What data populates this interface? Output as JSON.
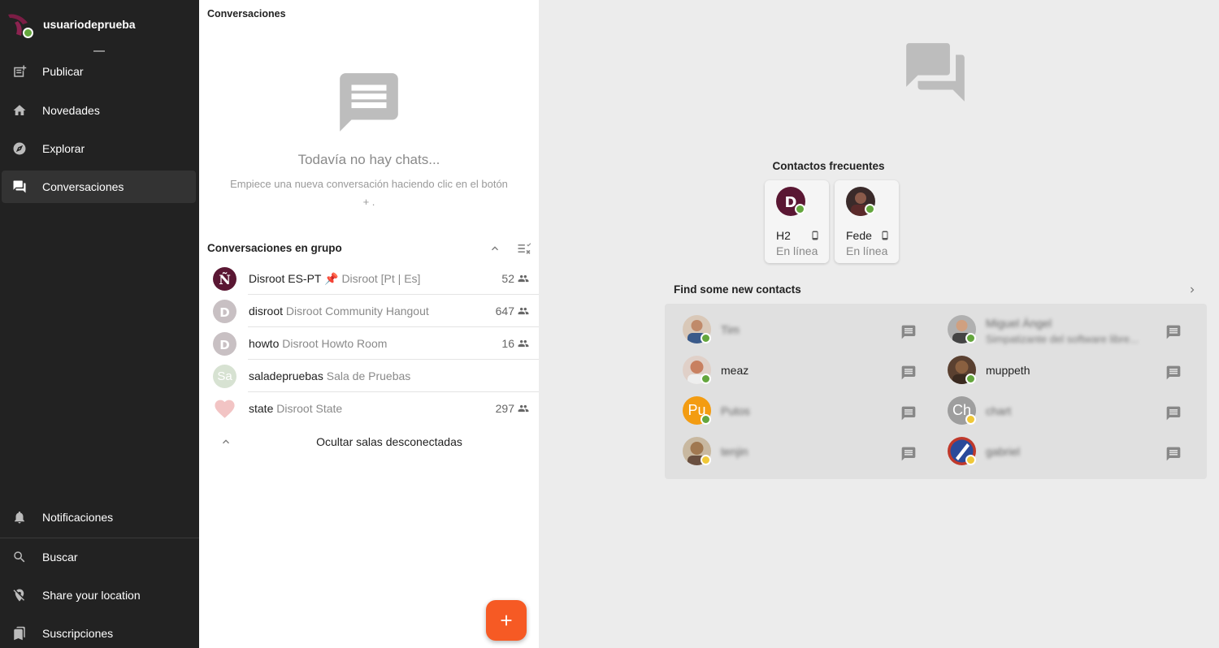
{
  "sidebar": {
    "username": "usuariodeprueba",
    "items": [
      {
        "label": "Publicar",
        "icon": "compose-icon"
      },
      {
        "label": "Novedades",
        "icon": "home-icon"
      },
      {
        "label": "Explorar",
        "icon": "compass-icon"
      },
      {
        "label": "Conversaciones",
        "icon": "chat-icon",
        "active": true
      }
    ],
    "bottom_items": [
      {
        "label": "Notificaciones",
        "icon": "bell-icon"
      },
      {
        "label": "Buscar",
        "icon": "search-icon"
      },
      {
        "label": "Share your location",
        "icon": "location-off-icon"
      },
      {
        "label": "Suscripciones",
        "icon": "bookmarks-icon"
      }
    ]
  },
  "conversations": {
    "title": "Conversaciones",
    "empty_title": "Todavía no hay chats...",
    "empty_subtitle": "Empiece una nueva conversación haciendo clic en el botón + .",
    "group_header": "Conversaciones en grupo",
    "rooms": [
      {
        "name": "Disroot ES-PT",
        "desc": "Disroot [Pt | Es]",
        "pinned": true,
        "count": "52"
      },
      {
        "name": "disroot",
        "desc": "Disroot Community Hangout",
        "count": "647"
      },
      {
        "name": "howto",
        "desc": "Disroot Howto Room",
        "count": "16"
      },
      {
        "name": "saladepruebas",
        "desc": "Sala de Pruebas",
        "initials": "Sa",
        "count": ""
      },
      {
        "name": "state",
        "desc": "Disroot State",
        "count": "297"
      }
    ],
    "hide_offline": "Ocultar salas desconectadas",
    "fab_label": "+"
  },
  "main": {
    "frequent_title": "Contactos frecuentes",
    "frequent": [
      {
        "name": "H2",
        "status": "En línea"
      },
      {
        "name": "Fede",
        "status": "En línea"
      }
    ],
    "find_title": "Find some new contacts",
    "contacts": [
      {
        "name": "Tim",
        "blur": true,
        "status": "online"
      },
      {
        "name": "Miguel Ángel",
        "sub": "Simpatizante del software libre...",
        "blur": true,
        "status": "online"
      },
      {
        "name": "meaz",
        "blur": false,
        "status": "online"
      },
      {
        "name": "muppeth",
        "blur": false,
        "status": "online"
      },
      {
        "name": "Putos",
        "initials": "Pu",
        "blur": true,
        "status": "online"
      },
      {
        "name": "chart",
        "initials": "Ch",
        "blur": true,
        "status": "away"
      },
      {
        "name": "tenjin",
        "blur": true,
        "status": "away"
      },
      {
        "name": "gabriel",
        "blur": true,
        "status": "away"
      }
    ]
  },
  "colors": {
    "sidebar_bg": "#222222",
    "accent": "#f65a24",
    "online": "#64a63d",
    "away": "#f0c838"
  }
}
